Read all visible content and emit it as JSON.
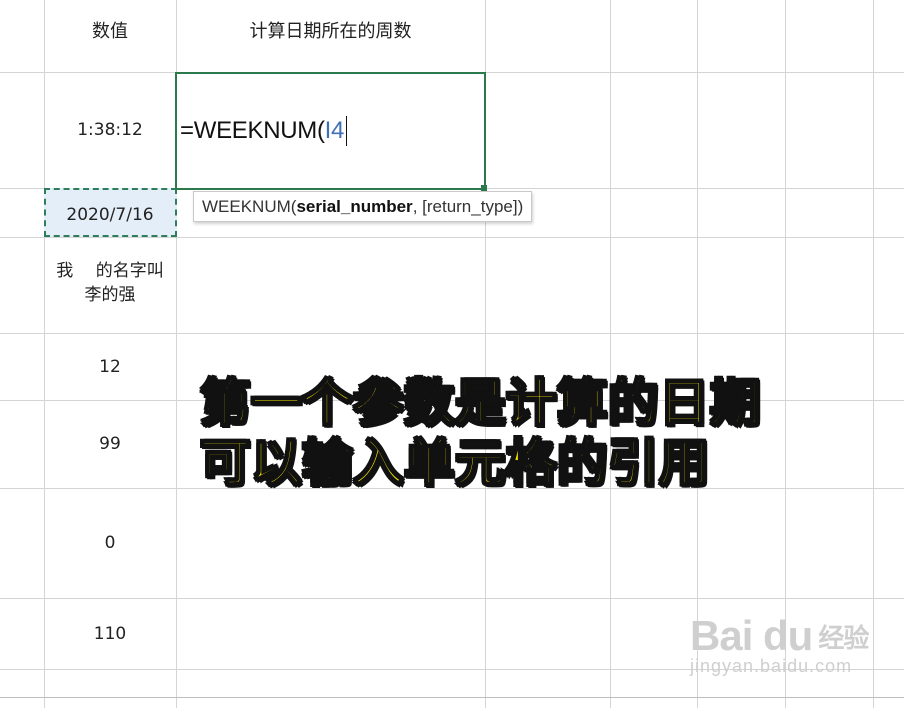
{
  "header": {
    "col_values": "数值",
    "col_weeknum": "计算日期所在的周数"
  },
  "rows": [
    {
      "value": "1:38:12"
    },
    {
      "value": "2020/7/16"
    },
    {
      "value_line1": "我　 的名字叫",
      "value_line2": "李的强"
    },
    {
      "value": "12"
    },
    {
      "value": "99"
    },
    {
      "value": "0"
    },
    {
      "value": "110"
    }
  ],
  "editor": {
    "formula_prefix": "=WEEKNUM(",
    "formula_ref": "I4"
  },
  "tooltip": {
    "fn": "WEEKNUM(",
    "arg1": "serial_number",
    "rest": ", [return_type])"
  },
  "overlay": {
    "line1": "第一个参数是计算的日期",
    "line2": "可以输入单元格的引用"
  },
  "watermark": {
    "brand": "Bai du",
    "cn": "经验",
    "sub": "jingyan.baidu.com"
  },
  "colors": {
    "edit_border": "#2a7a4b",
    "ref_blue": "#3f6fb5",
    "overlay_yellow": "#f7e600"
  }
}
